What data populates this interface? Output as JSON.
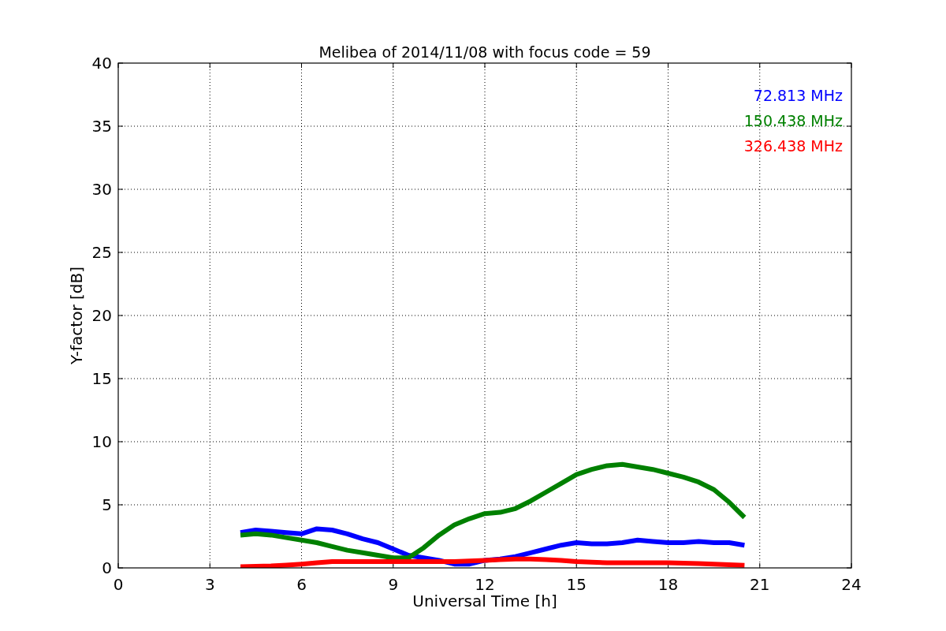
{
  "figure": {
    "chart_data": {
      "type": "line",
      "title": "Melibea of 2014/11/08 with focus code = 59",
      "xlabel": "Universal Time [h]",
      "ylabel": "Y-factor [dB]",
      "x": [
        4,
        4.5,
        5,
        5.5,
        6,
        6.5,
        7,
        7.5,
        8,
        8.5,
        9,
        9.5,
        10,
        10.5,
        11,
        11.5,
        12,
        12.5,
        13,
        13.5,
        14,
        14.5,
        15,
        15.5,
        16,
        16.5,
        17,
        17.5,
        18,
        18.5,
        19,
        19.5,
        20,
        20.5
      ],
      "series": [
        {
          "name": "72.813 MHz",
          "color": "#0000ff",
          "values": [
            2.8,
            3.0,
            2.9,
            2.8,
            2.7,
            3.1,
            3.0,
            2.7,
            2.3,
            2.0,
            1.5,
            1.0,
            0.8,
            0.6,
            0.3,
            0.3,
            0.6,
            0.7,
            0.9,
            1.2,
            1.5,
            1.8,
            2.0,
            1.9,
            1.9,
            2.0,
            2.2,
            2.1,
            2.0,
            2.0,
            2.1,
            2.0,
            2.0,
            1.8
          ]
        },
        {
          "name": "150.438 MHz",
          "color": "#008000",
          "values": [
            2.6,
            2.7,
            2.6,
            2.4,
            2.2,
            2.0,
            1.7,
            1.4,
            1.2,
            1.0,
            0.8,
            0.8,
            1.6,
            2.6,
            3.4,
            3.9,
            4.3,
            4.4,
            4.7,
            5.3,
            6.0,
            6.7,
            7.4,
            7.8,
            8.1,
            8.2,
            8.0,
            7.8,
            7.5,
            7.2,
            6.8,
            6.2,
            5.2,
            4.0
          ]
        },
        {
          "name": "326.438 MHz",
          "color": "#ff0000",
          "values": [
            0.1,
            0.12,
            0.15,
            0.22,
            0.3,
            0.4,
            0.5,
            0.5,
            0.5,
            0.5,
            0.5,
            0.5,
            0.5,
            0.5,
            0.5,
            0.55,
            0.6,
            0.65,
            0.7,
            0.7,
            0.65,
            0.6,
            0.5,
            0.45,
            0.4,
            0.4,
            0.4,
            0.4,
            0.4,
            0.38,
            0.35,
            0.3,
            0.25,
            0.2
          ]
        }
      ],
      "grid": true,
      "xlim": [
        0,
        24
      ],
      "ylim": [
        0,
        40
      ],
      "xticks": [
        0,
        3,
        6,
        9,
        12,
        15,
        18,
        21,
        24
      ],
      "yticks": [
        0,
        5,
        10,
        15,
        20,
        25,
        30,
        35,
        40
      ]
    }
  }
}
